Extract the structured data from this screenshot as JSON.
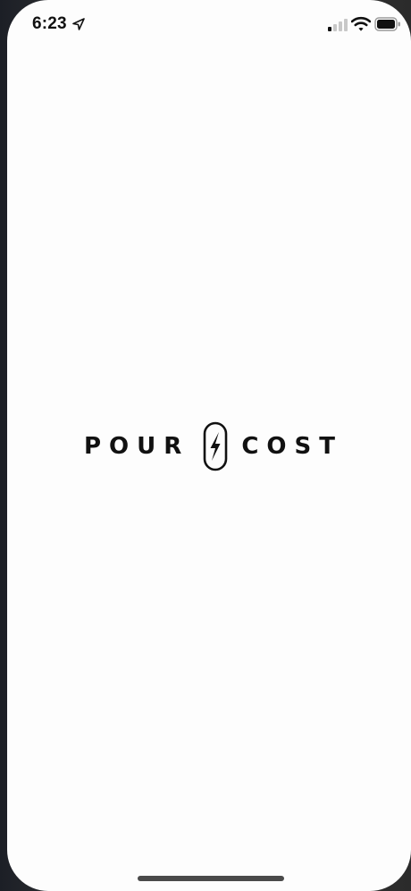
{
  "status_bar": {
    "time": "6:23",
    "location_icon": "location-arrow-icon",
    "signal_icon": "cellular-signal-icon",
    "wifi_icon": "wifi-icon",
    "battery_icon": "battery-icon"
  },
  "splash": {
    "logo_word_left": "POUR",
    "logo_word_right": "COST",
    "logo_mark_icon": "lightning-bolt-pill-icon"
  },
  "colors": {
    "background": "#fdfdfd",
    "text": "#111111",
    "home_indicator": "#4a4a4a"
  }
}
